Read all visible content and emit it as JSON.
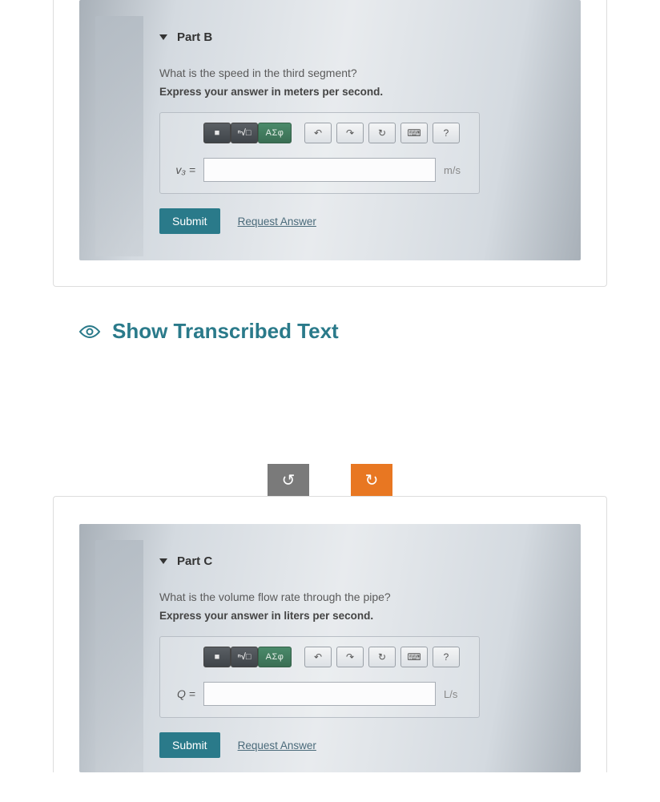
{
  "partB": {
    "title": "Part B",
    "question": "What is the speed in the third segment?",
    "instruction": "Express your answer in meters per second.",
    "toolbar": {
      "template": "■",
      "radical": "ⁿ√□",
      "greek": "ΑΣφ",
      "undo": "↶",
      "redo": "↷",
      "reset": "↻",
      "keyboard": "⌨",
      "help": "?"
    },
    "var_label": "v₃ =",
    "unit": "m/s",
    "submit": "Submit",
    "request": "Request Answer"
  },
  "transcribed": {
    "label": "Show Transcribed Text"
  },
  "controls": {
    "rotate_left": "↺",
    "rotate_right": "↻"
  },
  "partC": {
    "title": "Part C",
    "question": "What is the volume flow rate through the pipe?",
    "instruction": "Express your answer in liters per second.",
    "toolbar": {
      "template": "■",
      "radical": "ⁿ√□",
      "greek": "ΑΣφ",
      "undo": "↶",
      "redo": "↷",
      "reset": "↻",
      "keyboard": "⌨",
      "help": "?"
    },
    "var_label": "Q =",
    "unit": "L/s",
    "submit": "Submit",
    "request": "Request Answer"
  }
}
